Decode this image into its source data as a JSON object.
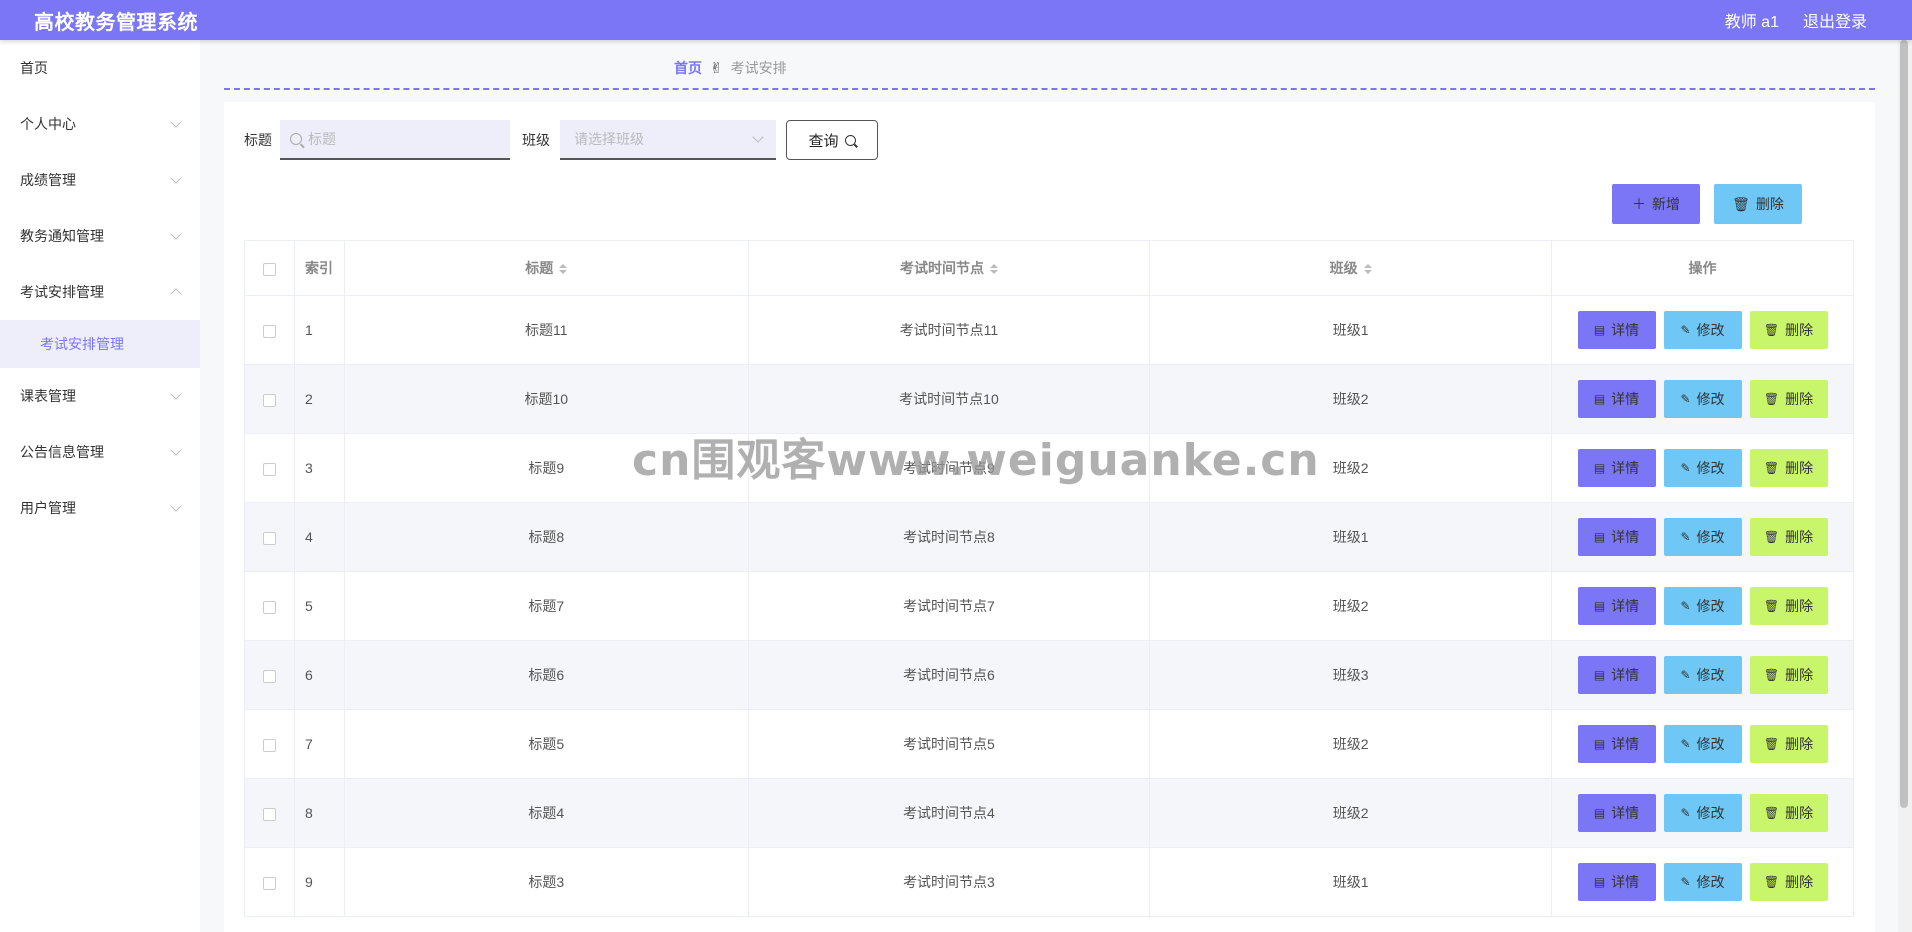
{
  "app": {
    "title": "高校教务管理系统"
  },
  "header": {
    "user": "教师 a1",
    "logout": "退出登录"
  },
  "sidebar": {
    "items": [
      {
        "label": "首页"
      },
      {
        "label": "个人中心"
      },
      {
        "label": "成绩管理"
      },
      {
        "label": "教务通知管理"
      },
      {
        "label": "考试安排管理"
      },
      {
        "label": "课表管理"
      },
      {
        "label": "公告信息管理"
      },
      {
        "label": "用户管理"
      }
    ],
    "active_sub": "考试安排管理"
  },
  "breadcrumb": {
    "home": "首页",
    "current": "考试安排"
  },
  "search": {
    "title_label": "标题",
    "title_placeholder": "标题",
    "class_label": "班级",
    "class_placeholder": "请选择班级",
    "query_label": "查询"
  },
  "actions": {
    "add": "新增",
    "delete": "删除"
  },
  "table": {
    "headers": {
      "index": "索引",
      "title": "标题",
      "time": "考试时间节点",
      "class": "班级",
      "ops": "操作"
    },
    "ops": {
      "detail": "详情",
      "edit": "修改",
      "delete": "删除"
    },
    "rows": [
      {
        "index": "1",
        "title": "标题11",
        "time": "考试时间节点11",
        "class": "班级1"
      },
      {
        "index": "2",
        "title": "标题10",
        "time": "考试时间节点10",
        "class": "班级2"
      },
      {
        "index": "3",
        "title": "标题9",
        "time": "考试时间节点9",
        "class": "班级2"
      },
      {
        "index": "4",
        "title": "标题8",
        "time": "考试时间节点8",
        "class": "班级1"
      },
      {
        "index": "5",
        "title": "标题7",
        "time": "考试时间节点7",
        "class": "班级2"
      },
      {
        "index": "6",
        "title": "标题6",
        "time": "考试时间节点6",
        "class": "班级3"
      },
      {
        "index": "7",
        "title": "标题5",
        "time": "考试时间节点5",
        "class": "班级2"
      },
      {
        "index": "8",
        "title": "标题4",
        "time": "考试时间节点4",
        "class": "班级2"
      },
      {
        "index": "9",
        "title": "标题3",
        "time": "考试时间节点3",
        "class": "班级1"
      }
    ]
  },
  "watermark": "cn围观客www.weiguanke.cn",
  "colors": {
    "primary": "#7a76f5",
    "info": "#6ec7f5",
    "success": "#c9f56b"
  }
}
